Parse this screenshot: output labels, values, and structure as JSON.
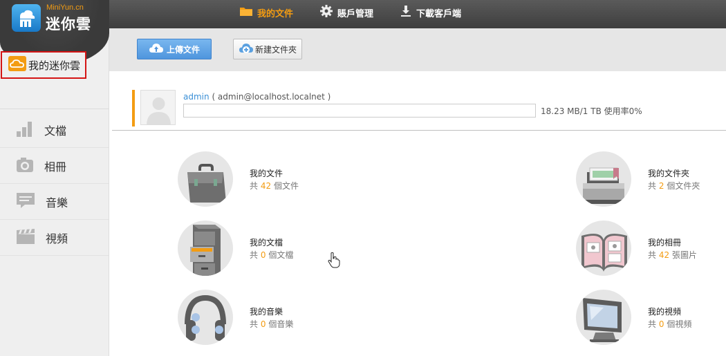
{
  "app": {
    "logo_sub": "MiniYun.cn",
    "logo_main": "迷你雲",
    "accent": "#f39c12",
    "brand_blue": "#4f95dd"
  },
  "topnav": [
    {
      "label": "我的文件",
      "icon": "folder-icon",
      "active": true
    },
    {
      "label": "賬戶管理",
      "icon": "gear-icon",
      "active": false
    },
    {
      "label": "下載客戶端",
      "icon": "download-icon",
      "active": false
    }
  ],
  "sidebar": {
    "mycloud": {
      "label": "我的迷你雲",
      "icon": "cloud-icon"
    },
    "items": [
      {
        "label": "文檔",
        "icon": "bar-chart-icon"
      },
      {
        "label": "相冊",
        "icon": "camera-icon"
      },
      {
        "label": "音樂",
        "icon": "speech-bubble-icon"
      },
      {
        "label": "視頻",
        "icon": "clapperboard-icon"
      }
    ]
  },
  "toolbar": {
    "upload_label": "上傳文件",
    "newfolder_label": "新建文件夾"
  },
  "user": {
    "name": "admin",
    "email": "( admin@localhost.localnet )",
    "quota_text": "18.23 MB/1 TB  使用率0%",
    "usage_fraction": 0
  },
  "categories": [
    {
      "title": "我的文件",
      "prefix": "共",
      "count": "42",
      "suffix": "個文件",
      "icon": "briefcase-icon"
    },
    {
      "title": "我的文件夾",
      "prefix": "共",
      "count": "2",
      "suffix": "個文件夾",
      "icon": "folder-tray-icon"
    },
    {
      "title": "我的文檔",
      "prefix": "共",
      "count": "0",
      "suffix": "個文檔",
      "icon": "file-cabinet-icon"
    },
    {
      "title": "我的相冊",
      "prefix": "共",
      "count": "42",
      "suffix": "張圖片",
      "icon": "photo-album-icon"
    },
    {
      "title": "我的音樂",
      "prefix": "共",
      "count": "0",
      "suffix": "個音樂",
      "icon": "headphones-icon"
    },
    {
      "title": "我的視頻",
      "prefix": "共",
      "count": "0",
      "suffix": "個視頻",
      "icon": "monitor-icon"
    }
  ]
}
